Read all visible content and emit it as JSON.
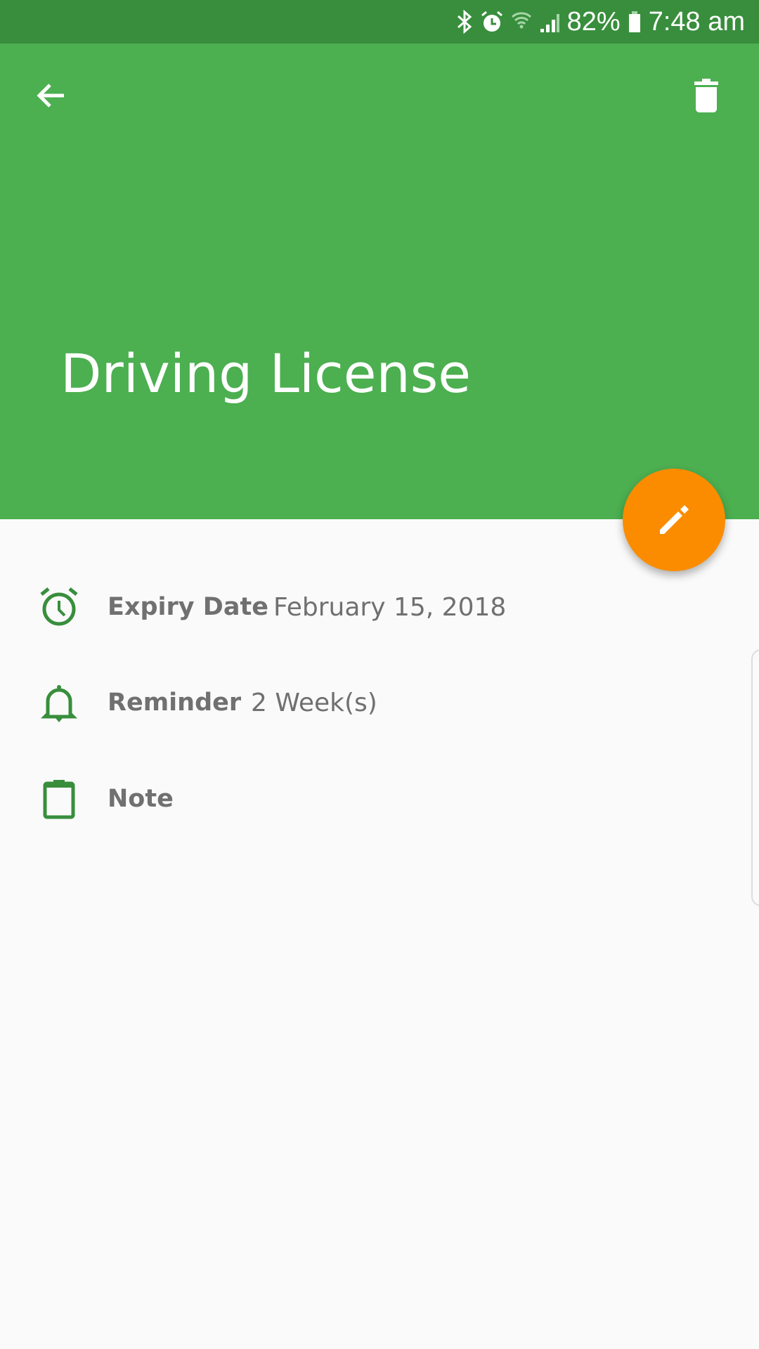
{
  "status_bar": {
    "battery": "82%",
    "time": "7:48 am",
    "icons": [
      "bluetooth-icon",
      "alarm-icon",
      "wifi-icon",
      "signal-icon",
      "battery-icon"
    ]
  },
  "header": {
    "title": "Driving License",
    "back_icon": "arrow-back-icon",
    "delete_icon": "trash-icon",
    "color": "#4caf50"
  },
  "fab": {
    "icon": "pencil-icon",
    "color": "#fb8c00"
  },
  "details": [
    {
      "icon": "alarm-clock-icon",
      "label": "Expiry Date",
      "value": "February 15, 2018"
    },
    {
      "icon": "bell-icon",
      "label": "Reminder",
      "value": "2 Week(s)"
    },
    {
      "icon": "clipboard-icon",
      "label": "Note",
      "value": ""
    }
  ]
}
